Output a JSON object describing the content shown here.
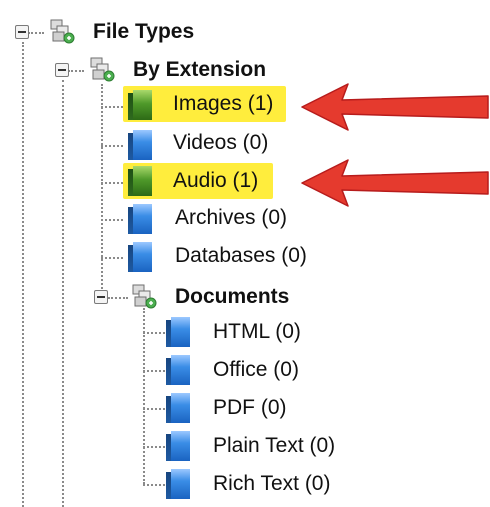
{
  "tree": {
    "root": {
      "label": "File Types",
      "icon": "group-node-icon"
    },
    "by_extension": {
      "label": "By Extension",
      "icon": "group-node-icon"
    },
    "extension_items": [
      {
        "label": "Images (1)",
        "icon": "file-icon",
        "color": "green",
        "highlighted": true
      },
      {
        "label": "Videos (0)",
        "icon": "file-icon",
        "color": "blue",
        "highlighted": false
      },
      {
        "label": "Audio (1)",
        "icon": "file-icon",
        "color": "green",
        "highlighted": true
      },
      {
        "label": "Archives (0)",
        "icon": "file-icon",
        "color": "blue",
        "highlighted": false
      },
      {
        "label": "Databases (0)",
        "icon": "file-icon",
        "color": "blue",
        "highlighted": false
      }
    ],
    "documents": {
      "label": "Documents",
      "icon": "group-node-icon"
    },
    "document_items": [
      {
        "label": "HTML (0)",
        "icon": "file-icon",
        "color": "blue"
      },
      {
        "label": "Office (0)",
        "icon": "file-icon",
        "color": "blue"
      },
      {
        "label": "PDF (0)",
        "icon": "file-icon",
        "color": "blue"
      },
      {
        "label": "Plain Text (0)",
        "icon": "file-icon",
        "color": "blue"
      },
      {
        "label": "Rich Text (0)",
        "icon": "file-icon",
        "color": "blue"
      }
    ]
  },
  "colors": {
    "highlight": "#ffed3d",
    "arrow": "#e53a2e",
    "blue_icon": "#2b78d6",
    "green_icon": "#3f8a22"
  }
}
